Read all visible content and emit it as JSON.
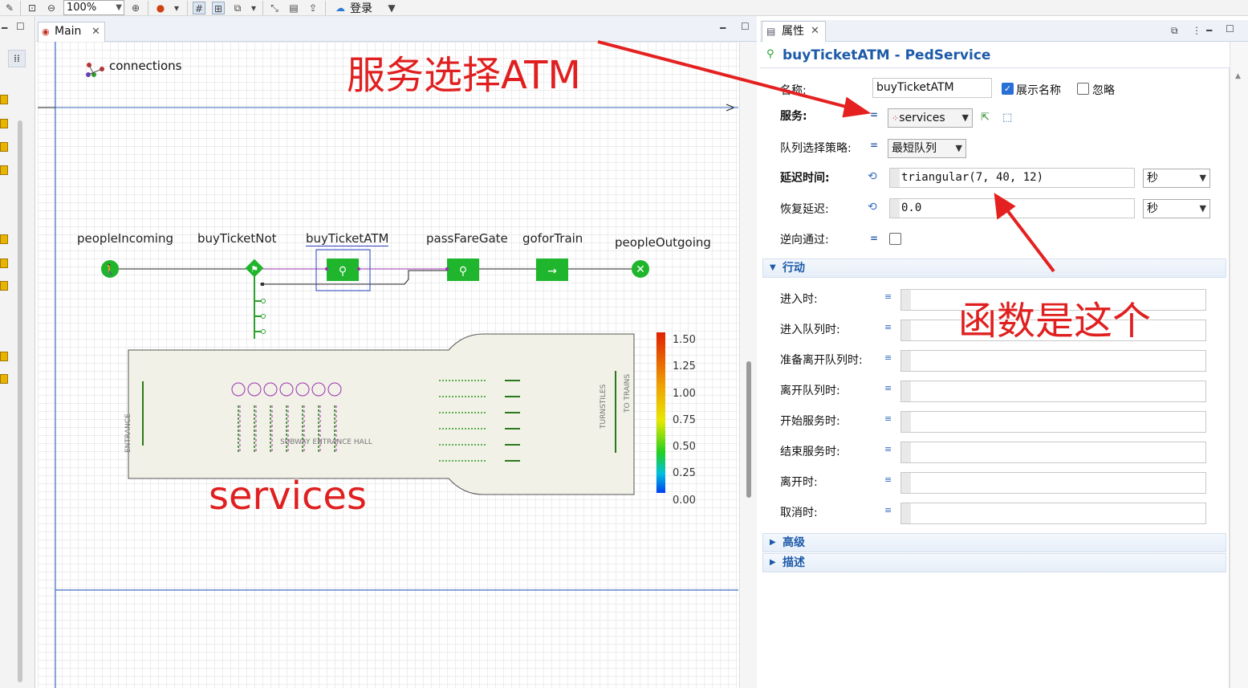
{
  "toolbar": {
    "zoom": "100%",
    "login": "登录"
  },
  "editor": {
    "tab": "Main"
  },
  "canvas": {
    "connections_label": "connections",
    "nodes": [
      "peopleIncoming",
      "buyTicketNot",
      "buyTicketATM",
      "passFareGate",
      "goforTrain",
      "peopleOutgoing"
    ],
    "hall": {
      "entrance": "ENTRANCE",
      "name": "SUBWAY ENTRANCE HALL",
      "turnstiles": "TURNSTILES",
      "to_trains": "TO TRAINS"
    },
    "legend_ticks": [
      "1.50",
      "1.25",
      "1.00",
      "0.75",
      "0.50",
      "0.25",
      "0.00"
    ]
  },
  "props": {
    "tab": "属性",
    "title": "buyTicketATM - PedService",
    "name_label": "名称:",
    "name_value": "buyTicketATM",
    "show_name": "展示名称",
    "ignore": "忽略",
    "service_label": "服务:",
    "service_value": "services",
    "queue_label": "队列选择策略:",
    "queue_value": "最短队列",
    "delay_label": "延迟时间:",
    "delay_value": "triangular(7, 40, 12)",
    "delay_unit": "秒",
    "recovery_label": "恢复延迟:",
    "recovery_value": "0.0",
    "recovery_unit": "秒",
    "reverse_label": "逆向通过:",
    "section_actions": "行动",
    "actions": [
      "进入时:",
      "进入队列时:",
      "准备离开队列时:",
      "离开队列时:",
      "开始服务时:",
      "结束服务时:",
      "离开时:",
      "取消时:"
    ],
    "section_advanced": "高级",
    "section_desc": "描述"
  },
  "annotations": {
    "service_choice": "服务选择ATM",
    "function_note": "函数是这个",
    "services_note": "services"
  },
  "colors": {
    "accent": "#1d5aa8",
    "annotation": "#e02020",
    "node_green": "#1fb52c"
  }
}
